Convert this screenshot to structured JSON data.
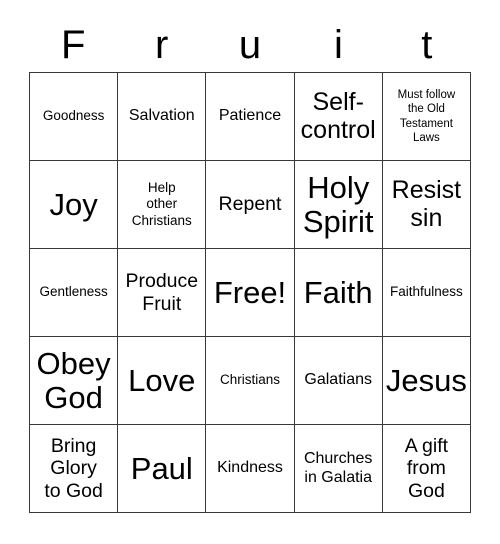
{
  "card": {
    "title": "Fruit",
    "title_letters": [
      "F",
      "r",
      "u",
      "i",
      "t"
    ],
    "border_color": "#3a3a3a",
    "background_color": "#ffffff",
    "text_color": "#000000",
    "grid_size": "5x5",
    "cells": [
      {
        "text": "Goodness",
        "size": "fs-sm"
      },
      {
        "text": "Salvation",
        "size": "fs-md"
      },
      {
        "text": "Patience",
        "size": "fs-md"
      },
      {
        "text": "Self-\ncontrol",
        "size": "fs-xl"
      },
      {
        "text": "Must follow\nthe Old\nTestament\nLaws",
        "size": "fs-xs"
      },
      {
        "text": "Joy",
        "size": "fs-xxl"
      },
      {
        "text": "Help\nother\nChristians",
        "size": "fs-sm"
      },
      {
        "text": "Repent",
        "size": "fs-lg"
      },
      {
        "text": "Holy\nSpirit",
        "size": "fs-xxl"
      },
      {
        "text": "Resist\nsin",
        "size": "fs-xl"
      },
      {
        "text": "Gentleness",
        "size": "fs-sm"
      },
      {
        "text": "Produce\nFruit",
        "size": "fs-lg"
      },
      {
        "text": "Free!",
        "size": "fs-xxl"
      },
      {
        "text": "Faith",
        "size": "fs-xxl"
      },
      {
        "text": "Faithfulness",
        "size": "fs-sm"
      },
      {
        "text": "Obey\nGod",
        "size": "fs-xxl"
      },
      {
        "text": "Love",
        "size": "fs-xxl"
      },
      {
        "text": "Christians",
        "size": "fs-sm"
      },
      {
        "text": "Galatians",
        "size": "fs-md"
      },
      {
        "text": "Jesus",
        "size": "fs-xxl"
      },
      {
        "text": "Bring\nGlory\nto God",
        "size": "fs-lg"
      },
      {
        "text": "Paul",
        "size": "fs-xxl"
      },
      {
        "text": "Kindness",
        "size": "fs-md"
      },
      {
        "text": "Churches\nin Galatia",
        "size": "fs-md"
      },
      {
        "text": "A gift\nfrom\nGod",
        "size": "fs-lg"
      }
    ]
  }
}
